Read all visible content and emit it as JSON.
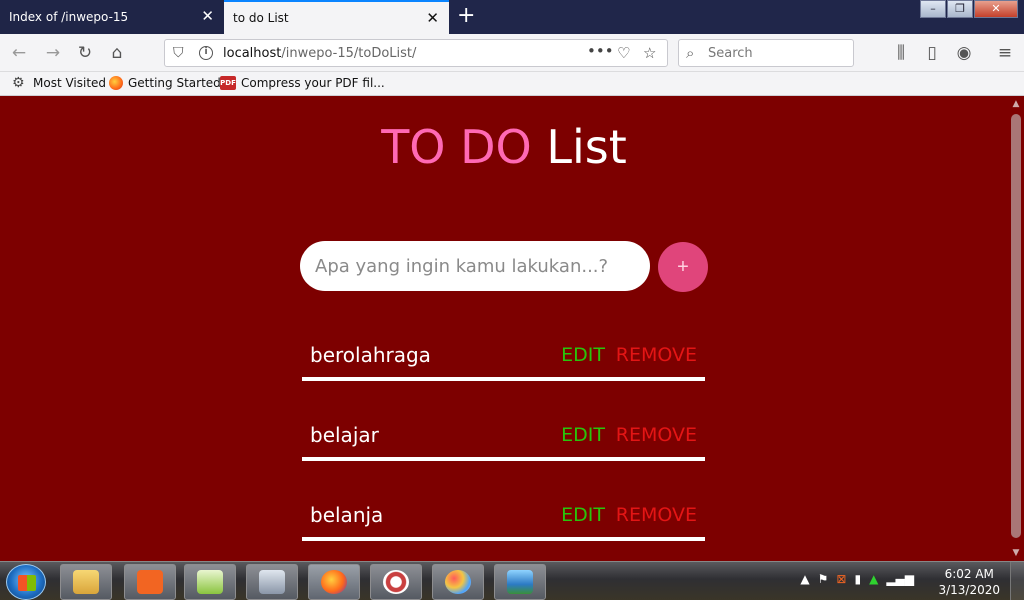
{
  "browser": {
    "tabs": [
      {
        "label": "Index of /inwepo-15",
        "active": false
      },
      {
        "label": "to do List",
        "active": true
      }
    ],
    "url_host": "localhost",
    "url_path": "/inwepo-15/toDoList/",
    "search_placeholder": "Search",
    "bookmarks": [
      {
        "label": "Most Visited",
        "icon": "gear-icon"
      },
      {
        "label": "Getting Started",
        "icon": "firefox-icon"
      },
      {
        "label": "Compress your PDF fil...",
        "icon": "pdf-icon"
      }
    ]
  },
  "app": {
    "title_part1": "TO DO",
    "title_part2": "List",
    "input_placeholder": "Apa yang ingin kamu lakukan...?",
    "add_label": "+",
    "edit_label": "EDIT",
    "remove_label": "REMOVE",
    "items": [
      {
        "text": "berolahraga"
      },
      {
        "text": "belajar"
      },
      {
        "text": "belanja"
      }
    ],
    "colors": {
      "background": "#7d0000",
      "title_accent": "#ff69b4",
      "add_button": "#e0457b",
      "edit": "#29c40b",
      "remove": "#e31515"
    }
  },
  "taskbar": {
    "time": "6:02 AM",
    "date": "3/13/2020",
    "apps": [
      "explorer-icon",
      "xampp-icon",
      "notepad-plus-icon",
      "calculator-icon",
      "firefox-icon",
      "snipping-tool-icon",
      "paint-icon",
      "photo-viewer-icon"
    ]
  }
}
